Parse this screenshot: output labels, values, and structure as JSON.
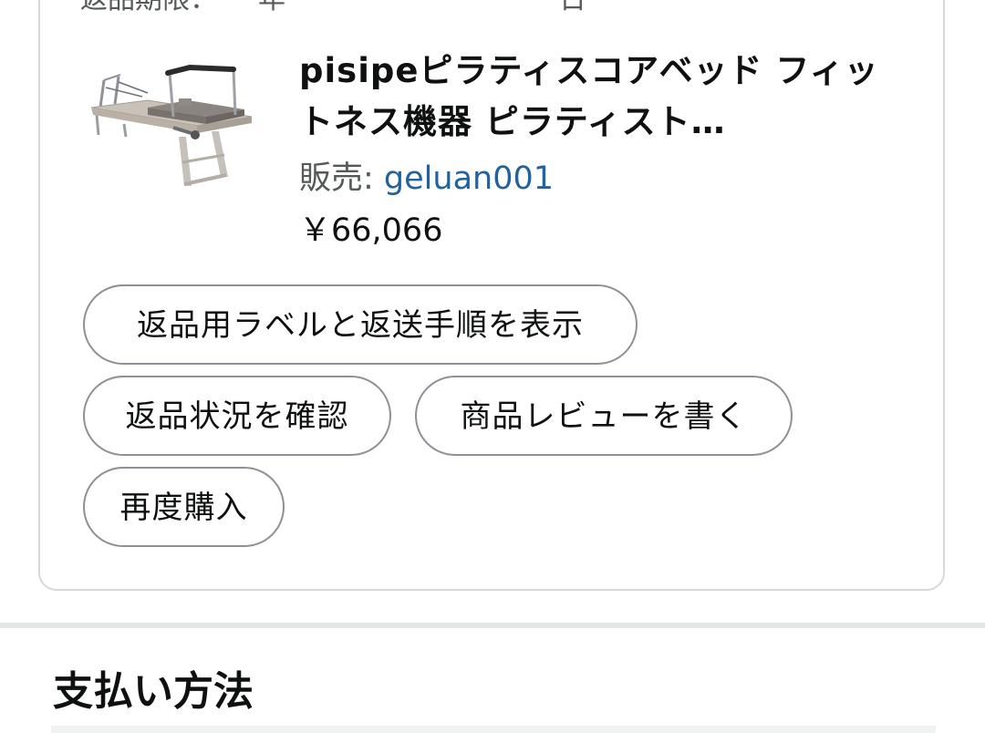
{
  "order_item": {
    "cut_off_text": "返品期限：　　年　　　　　　　　　　日",
    "product_title": "pisipeピラティスコアベッド フィットネス機器 ピラティスト…",
    "seller_label": "販売: ",
    "seller_name": "geluan001",
    "price": "￥66,066",
    "image_icon": "pilates-reformer-image"
  },
  "actions": [
    {
      "label": "返品用ラベルと返送手順を表示"
    },
    {
      "label": "返品状況を確認"
    },
    {
      "label": "商品レビューを書く"
    },
    {
      "label": "再度購入"
    }
  ],
  "payment_section": {
    "title": "支払い方法"
  },
  "colors": {
    "link": "#2162a1",
    "border": "#d5d9d9",
    "chip_border": "#8d9096",
    "divider": "#e3e6e6",
    "text": "#0f1111",
    "muted": "#565959"
  }
}
